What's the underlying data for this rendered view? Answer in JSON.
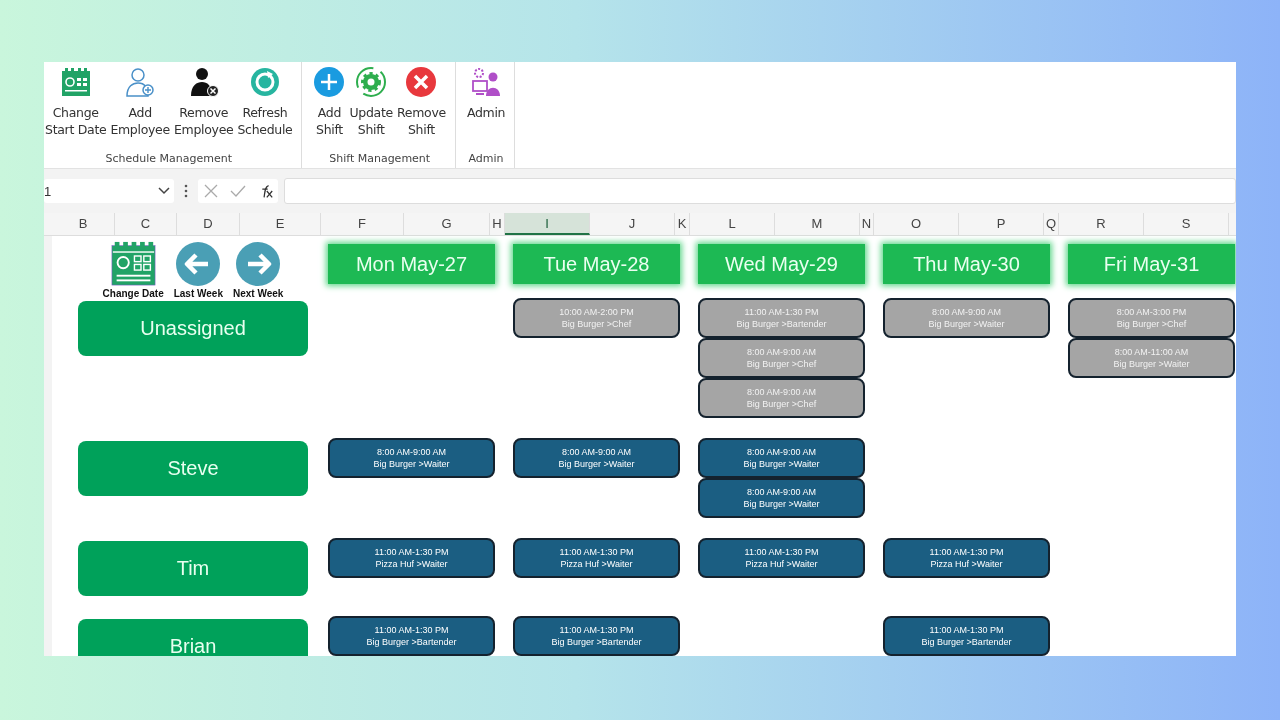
{
  "ribbon": {
    "groups": [
      {
        "label": "Schedule Management",
        "buttons": [
          {
            "kind": "calendar",
            "lines": [
              "Change",
              "Start Date"
            ]
          },
          {
            "kind": "add-person",
            "lines": [
              "Add",
              "Employee"
            ]
          },
          {
            "kind": "remove-person",
            "lines": [
              "Remove",
              "Employee"
            ]
          },
          {
            "kind": "refresh",
            "lines": [
              "Refresh",
              "Schedule"
            ]
          }
        ]
      },
      {
        "label": "Shift Management",
        "buttons": [
          {
            "kind": "plus",
            "lines": [
              "Add",
              "Shift"
            ]
          },
          {
            "kind": "gear",
            "lines": [
              "Update",
              "Shift"
            ]
          },
          {
            "kind": "cross",
            "lines": [
              "Remove",
              "Shift"
            ]
          }
        ]
      },
      {
        "label": "Admin",
        "buttons": [
          {
            "kind": "admin",
            "lines": [
              "Admin"
            ]
          }
        ]
      }
    ]
  },
  "formula_bar": {
    "name_box": "1"
  },
  "columns": [
    {
      "label": "B",
      "selected": false
    },
    {
      "label": "C",
      "selected": false
    },
    {
      "label": "D",
      "selected": false
    },
    {
      "label": "E",
      "selected": false
    },
    {
      "label": "F",
      "selected": false
    },
    {
      "label": "G",
      "selected": false
    },
    {
      "label": "H",
      "selected": false
    },
    {
      "label": "I",
      "selected": true
    },
    {
      "label": "J",
      "selected": false
    },
    {
      "label": "K",
      "selected": false
    },
    {
      "label": "L",
      "selected": false
    },
    {
      "label": "M",
      "selected": false
    },
    {
      "label": "N",
      "selected": false
    },
    {
      "label": "O",
      "selected": false
    },
    {
      "label": "P",
      "selected": false
    },
    {
      "label": "Q",
      "selected": false
    },
    {
      "label": "R",
      "selected": false
    },
    {
      "label": "S",
      "selected": false
    }
  ],
  "controls": [
    {
      "kind": "calendar",
      "label": "Change Date"
    },
    {
      "kind": "left",
      "label": "Last Week"
    },
    {
      "kind": "right",
      "label": "Next Week"
    }
  ],
  "days": [
    "Mon May-27",
    "Tue May-28",
    "Wed May-29",
    "Thu May-30",
    "Fri May-31"
  ],
  "rows": [
    {
      "name": "Unassigned",
      "kind": "unassigned",
      "tue": [
        {
          "time": "10:00 AM-2:00 PM",
          "job": "Big Burger >Chef"
        }
      ],
      "wed": [
        {
          "time": "11:00 AM-1:30 PM",
          "job": "Big Burger >Bartender"
        },
        {
          "time": "8:00 AM-9:00 AM",
          "job": "Big Burger >Chef"
        },
        {
          "time": "8:00 AM-9:00 AM",
          "job": "Big Burger >Chef"
        }
      ],
      "thu": [
        {
          "time": "8:00 AM-9:00 AM",
          "job": "Big Burger >Waiter"
        }
      ],
      "fri": [
        {
          "time": "8:00 AM-3:00 PM",
          "job": "Big Burger >Chef"
        },
        {
          "time": "8:00 AM-11:00 AM",
          "job": "Big Burger >Waiter"
        }
      ]
    },
    {
      "name": "Steve",
      "kind": "employee",
      "mon": [
        {
          "time": "8:00 AM-9:00 AM",
          "job": "Big Burger >Waiter"
        }
      ],
      "tue": [
        {
          "time": "8:00 AM-9:00 AM",
          "job": "Big Burger >Waiter"
        }
      ],
      "wed": [
        {
          "time": "8:00 AM-9:00 AM",
          "job": "Big Burger >Waiter"
        },
        {
          "time": "8:00 AM-9:00 AM",
          "job": "Big Burger >Waiter"
        }
      ]
    },
    {
      "name": "Tim",
      "kind": "employee",
      "mon": [
        {
          "time": "11:00 AM-1:30 PM",
          "job": "Pizza Huf >Waiter"
        }
      ],
      "tue": [
        {
          "time": "11:00 AM-1:30 PM",
          "job": "Pizza Huf >Waiter"
        }
      ],
      "wed": [
        {
          "time": "11:00 AM-1:30 PM",
          "job": "Pizza Huf >Waiter"
        }
      ],
      "thu": [
        {
          "time": "11:00 AM-1:30 PM",
          "job": "Pizza Huf >Waiter"
        }
      ]
    },
    {
      "name": "Brian",
      "kind": "employee",
      "mon": [
        {
          "time": "11:00 AM-1:30 PM",
          "job": "Big Burger >Bartender"
        }
      ],
      "tue": [
        {
          "time": "11:00 AM-1:30 PM",
          "job": "Big Burger >Bartender"
        }
      ],
      "thu": [
        {
          "time": "11:00 AM-1:30 PM",
          "job": "Big Burger >Bartender"
        }
      ]
    }
  ]
}
